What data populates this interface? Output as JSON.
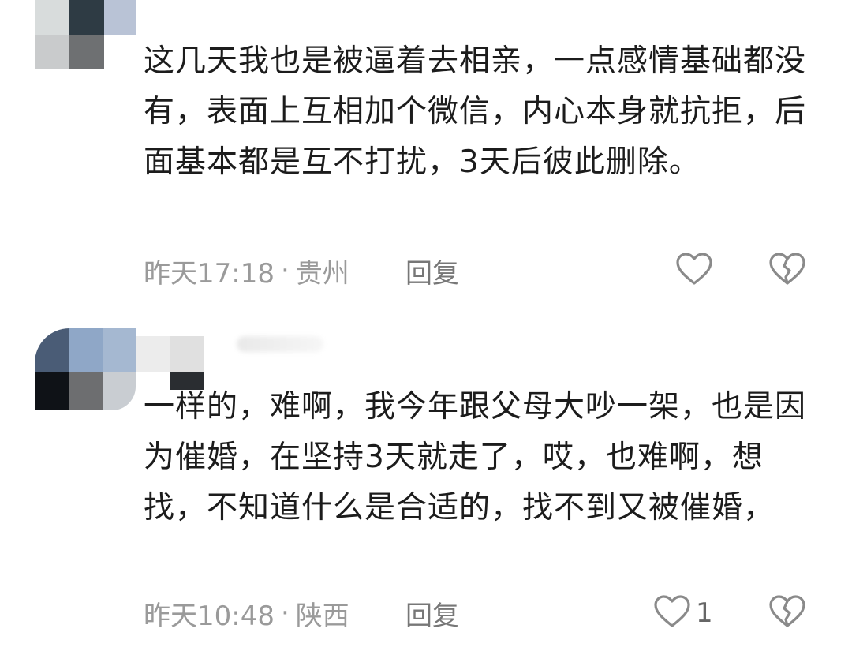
{
  "comments": [
    {
      "text": "这几天我也是被逼着去相亲，一点感情基础都没有，表面上互相加个微信，内心本身就抗拒，后面基本都是互不打扰，3天后彼此删除。",
      "time": "昨天17:18",
      "separator": "·",
      "location": "贵州",
      "reply_label": "回复",
      "like_count": "",
      "icons": {
        "like": "heart-outline-icon",
        "dislike": "broken-heart-icon"
      }
    },
    {
      "text": "一样的，难啊，我今年跟父母大吵一架，也是因为催婚，在坚持3天就走了，哎，也难啊，想找，不知道什么是合适的，找不到又被催婚，",
      "time": "昨天10:48",
      "separator": "·",
      "location": "陕西",
      "reply_label": "回复",
      "like_count": "1",
      "icons": {
        "like": "heart-outline-icon",
        "dislike": "broken-heart-icon"
      }
    }
  ],
  "colors": {
    "text": "#1c1c1c",
    "meta": "#9a9a9a",
    "icon": "#8a8a8a"
  }
}
